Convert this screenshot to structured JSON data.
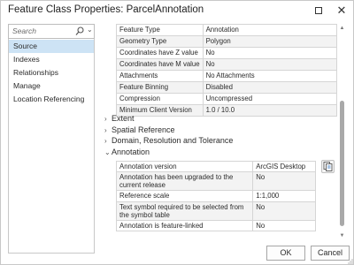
{
  "window": {
    "title": "Feature Class Properties: ParcelAnnotation"
  },
  "search": {
    "placeholder": "Search"
  },
  "nav": {
    "items": [
      {
        "label": "Source",
        "selected": true
      },
      {
        "label": "Indexes",
        "selected": false
      },
      {
        "label": "Relationships",
        "selected": false
      },
      {
        "label": "Manage",
        "selected": false
      },
      {
        "label": "Location Referencing",
        "selected": false
      }
    ]
  },
  "props_table": [
    [
      "Feature Type",
      "Annotation"
    ],
    [
      "Geometry Type",
      "Polygon"
    ],
    [
      "Coordinates have Z value",
      "No"
    ],
    [
      "Coordinates have M value",
      "No"
    ],
    [
      "Attachments",
      "No Attachments"
    ],
    [
      "Feature Binning",
      "Disabled"
    ],
    [
      "Compression",
      "Uncompressed"
    ],
    [
      "Minimum Client Version",
      "1.0 / 10.0"
    ]
  ],
  "sections": [
    {
      "label": "Extent",
      "expanded": false
    },
    {
      "label": "Spatial Reference",
      "expanded": false
    },
    {
      "label": "Domain, Resolution and Tolerance",
      "expanded": false
    },
    {
      "label": "Annotation",
      "expanded": true
    }
  ],
  "annotation_table": [
    [
      "Annotation version",
      "ArcGIS Desktop"
    ],
    [
      "Annotation has been upgraded to the current release",
      "No"
    ],
    [
      "Reference scale",
      "1:1,000"
    ],
    [
      "Text symbol required to be selected from the symbol table",
      "No"
    ],
    [
      "Annotation is feature-linked",
      "No"
    ]
  ],
  "footer": {
    "ok_label": "OK",
    "cancel_label": "Cancel"
  },
  "icons": {
    "search": "search-icon",
    "chevron_down": "chevron-down-icon",
    "copy": "copy-icon",
    "maximize": "maximize-icon",
    "close": "close-icon"
  },
  "colors": {
    "selected_bg": "#cde3f5",
    "border": "#d5d5d5",
    "alt_row": "#f3f3f3"
  }
}
